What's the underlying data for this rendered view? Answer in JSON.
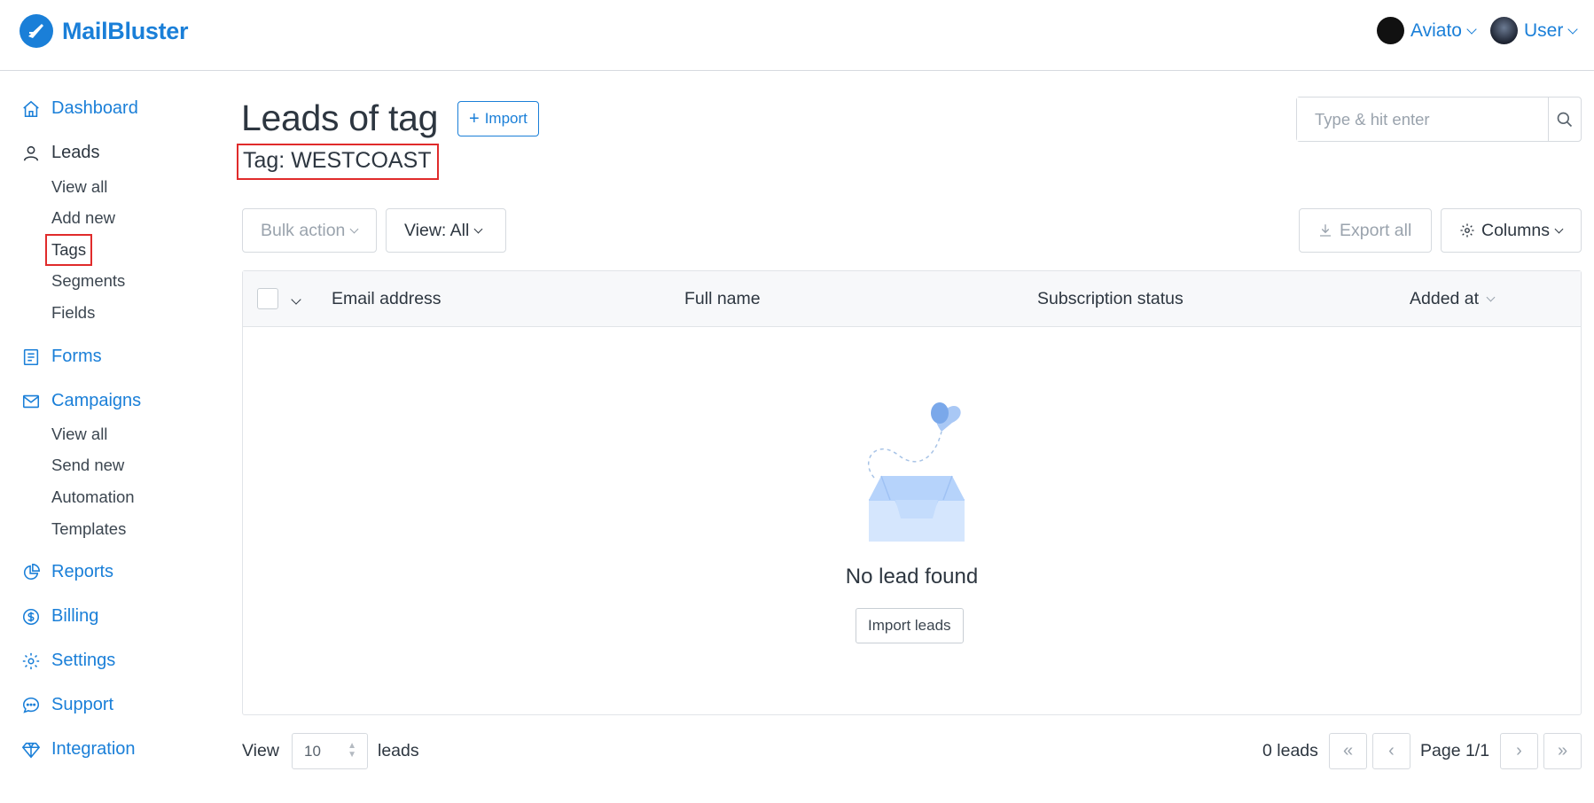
{
  "app": {
    "name": "MailBluster",
    "brand_color": "#1a7fd8",
    "highlight_color": "#e02b2b"
  },
  "header": {
    "accounts": [
      {
        "label": "Aviato",
        "icon": "avatar-aviato"
      },
      {
        "label": "User",
        "icon": "avatar-user"
      }
    ]
  },
  "sidebar": {
    "main": [
      {
        "label": "Dashboard",
        "icon": "home-icon"
      },
      {
        "label": "Leads",
        "icon": "user-icon"
      },
      {
        "label": "Forms",
        "icon": "form-icon"
      },
      {
        "label": "Campaigns",
        "icon": "mail-icon"
      },
      {
        "label": "Reports",
        "icon": "pie-chart-icon"
      },
      {
        "label": "Billing",
        "icon": "dollar-icon"
      },
      {
        "label": "Settings",
        "icon": "gear-icon"
      },
      {
        "label": "Support",
        "icon": "chat-icon"
      },
      {
        "label": "Integration",
        "icon": "diamond-icon"
      }
    ],
    "leads_sub": [
      "View all",
      "Add new",
      "Tags",
      "Segments",
      "Fields"
    ],
    "campaigns_sub": [
      "View all",
      "Send new",
      "Automation",
      "Templates"
    ],
    "active_item": "Tags"
  },
  "main": {
    "title": "Leads of tag",
    "import_label": "Import",
    "tag_label": "Tag: WESTCOAST",
    "search_placeholder": "Type & hit enter",
    "toolbar": {
      "bulk_action": "Bulk action",
      "view_filter": "View: All",
      "export_all": "Export all",
      "columns": "Columns"
    },
    "table": {
      "columns": [
        "Email address",
        "Full name",
        "Subscription status",
        "Added at"
      ],
      "rows": [],
      "empty_text": "No lead found",
      "empty_button": "Import leads"
    },
    "footer": {
      "view_label": "View",
      "per_page": "10",
      "leads_label": "leads",
      "count": "0 leads",
      "page": "Page 1/1"
    }
  }
}
